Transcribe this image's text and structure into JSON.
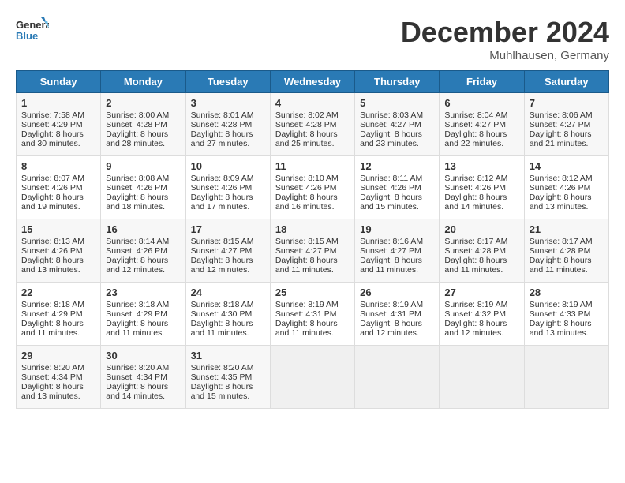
{
  "header": {
    "logo_line1": "General",
    "logo_line2": "Blue",
    "month": "December 2024",
    "location": "Muhlhausen, Germany"
  },
  "days_of_week": [
    "Sunday",
    "Monday",
    "Tuesday",
    "Wednesday",
    "Thursday",
    "Friday",
    "Saturday"
  ],
  "weeks": [
    [
      {
        "day": "1",
        "sunrise": "7:58 AM",
        "sunset": "4:29 PM",
        "daylight": "8 hours and 30 minutes."
      },
      {
        "day": "2",
        "sunrise": "8:00 AM",
        "sunset": "4:28 PM",
        "daylight": "8 hours and 28 minutes."
      },
      {
        "day": "3",
        "sunrise": "8:01 AM",
        "sunset": "4:28 PM",
        "daylight": "8 hours and 27 minutes."
      },
      {
        "day": "4",
        "sunrise": "8:02 AM",
        "sunset": "4:28 PM",
        "daylight": "8 hours and 25 minutes."
      },
      {
        "day": "5",
        "sunrise": "8:03 AM",
        "sunset": "4:27 PM",
        "daylight": "8 hours and 23 minutes."
      },
      {
        "day": "6",
        "sunrise": "8:04 AM",
        "sunset": "4:27 PM",
        "daylight": "8 hours and 22 minutes."
      },
      {
        "day": "7",
        "sunrise": "8:06 AM",
        "sunset": "4:27 PM",
        "daylight": "8 hours and 21 minutes."
      }
    ],
    [
      {
        "day": "8",
        "sunrise": "8:07 AM",
        "sunset": "4:26 PM",
        "daylight": "8 hours and 19 minutes."
      },
      {
        "day": "9",
        "sunrise": "8:08 AM",
        "sunset": "4:26 PM",
        "daylight": "8 hours and 18 minutes."
      },
      {
        "day": "10",
        "sunrise": "8:09 AM",
        "sunset": "4:26 PM",
        "daylight": "8 hours and 17 minutes."
      },
      {
        "day": "11",
        "sunrise": "8:10 AM",
        "sunset": "4:26 PM",
        "daylight": "8 hours and 16 minutes."
      },
      {
        "day": "12",
        "sunrise": "8:11 AM",
        "sunset": "4:26 PM",
        "daylight": "8 hours and 15 minutes."
      },
      {
        "day": "13",
        "sunrise": "8:12 AM",
        "sunset": "4:26 PM",
        "daylight": "8 hours and 14 minutes."
      },
      {
        "day": "14",
        "sunrise": "8:12 AM",
        "sunset": "4:26 PM",
        "daylight": "8 hours and 13 minutes."
      }
    ],
    [
      {
        "day": "15",
        "sunrise": "8:13 AM",
        "sunset": "4:26 PM",
        "daylight": "8 hours and 13 minutes."
      },
      {
        "day": "16",
        "sunrise": "8:14 AM",
        "sunset": "4:26 PM",
        "daylight": "8 hours and 12 minutes."
      },
      {
        "day": "17",
        "sunrise": "8:15 AM",
        "sunset": "4:27 PM",
        "daylight": "8 hours and 12 minutes."
      },
      {
        "day": "18",
        "sunrise": "8:15 AM",
        "sunset": "4:27 PM",
        "daylight": "8 hours and 11 minutes."
      },
      {
        "day": "19",
        "sunrise": "8:16 AM",
        "sunset": "4:27 PM",
        "daylight": "8 hours and 11 minutes."
      },
      {
        "day": "20",
        "sunrise": "8:17 AM",
        "sunset": "4:28 PM",
        "daylight": "8 hours and 11 minutes."
      },
      {
        "day": "21",
        "sunrise": "8:17 AM",
        "sunset": "4:28 PM",
        "daylight": "8 hours and 11 minutes."
      }
    ],
    [
      {
        "day": "22",
        "sunrise": "8:18 AM",
        "sunset": "4:29 PM",
        "daylight": "8 hours and 11 minutes."
      },
      {
        "day": "23",
        "sunrise": "8:18 AM",
        "sunset": "4:29 PM",
        "daylight": "8 hours and 11 minutes."
      },
      {
        "day": "24",
        "sunrise": "8:18 AM",
        "sunset": "4:30 PM",
        "daylight": "8 hours and 11 minutes."
      },
      {
        "day": "25",
        "sunrise": "8:19 AM",
        "sunset": "4:31 PM",
        "daylight": "8 hours and 11 minutes."
      },
      {
        "day": "26",
        "sunrise": "8:19 AM",
        "sunset": "4:31 PM",
        "daylight": "8 hours and 12 minutes."
      },
      {
        "day": "27",
        "sunrise": "8:19 AM",
        "sunset": "4:32 PM",
        "daylight": "8 hours and 12 minutes."
      },
      {
        "day": "28",
        "sunrise": "8:19 AM",
        "sunset": "4:33 PM",
        "daylight": "8 hours and 13 minutes."
      }
    ],
    [
      {
        "day": "29",
        "sunrise": "8:20 AM",
        "sunset": "4:34 PM",
        "daylight": "8 hours and 13 minutes."
      },
      {
        "day": "30",
        "sunrise": "8:20 AM",
        "sunset": "4:34 PM",
        "daylight": "8 hours and 14 minutes."
      },
      {
        "day": "31",
        "sunrise": "8:20 AM",
        "sunset": "4:35 PM",
        "daylight": "8 hours and 15 minutes."
      },
      null,
      null,
      null,
      null
    ]
  ]
}
